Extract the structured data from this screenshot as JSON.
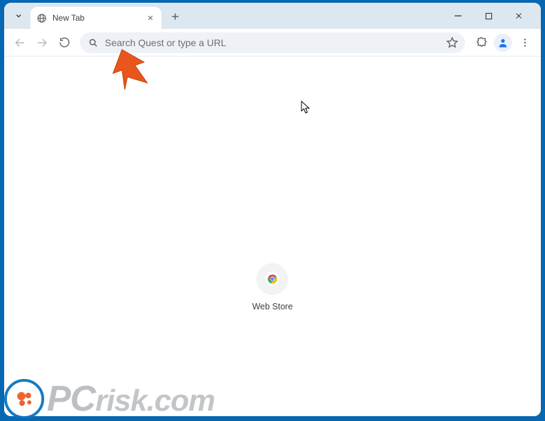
{
  "tab": {
    "title": "New Tab"
  },
  "omnibox": {
    "placeholder": "Search Quest or type a URL"
  },
  "shortcut": {
    "label": "Web Store"
  },
  "watermark": {
    "brand_pc": "PC",
    "brand_rest": "risk.com"
  }
}
